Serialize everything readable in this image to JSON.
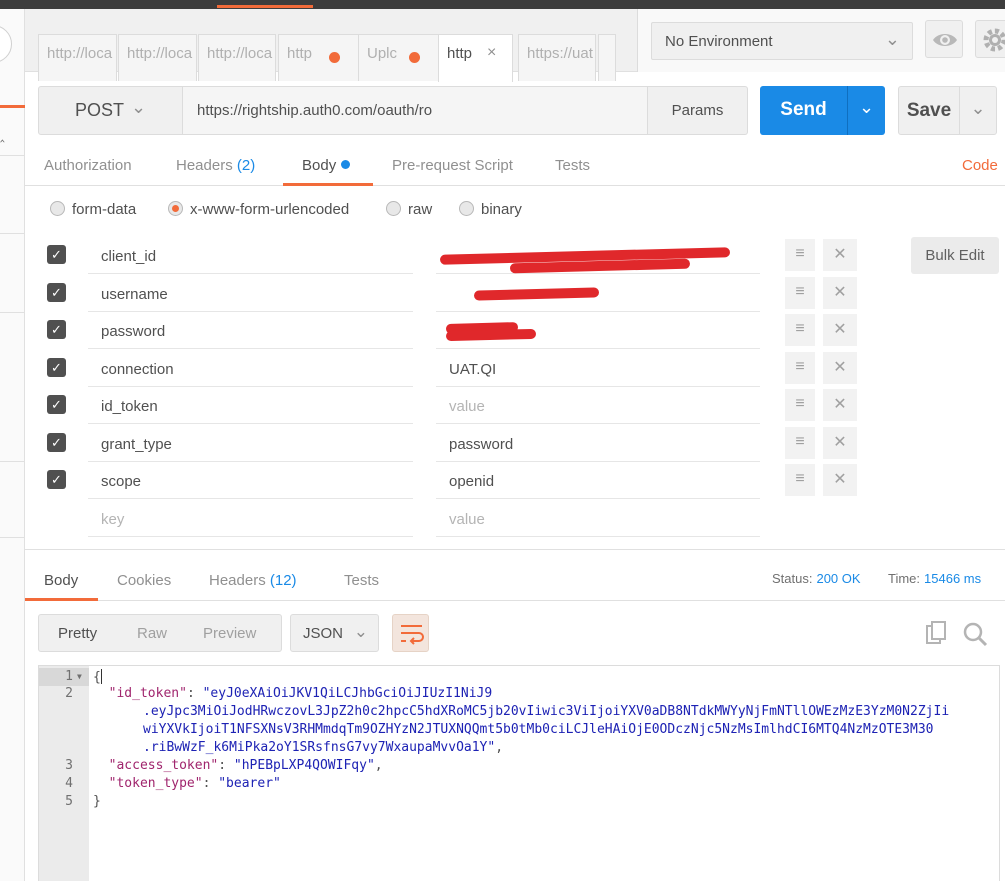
{
  "tabs": [
    {
      "label": "http://loca",
      "dot": false,
      "active": false
    },
    {
      "label": "http://loca",
      "dot": false,
      "active": false
    },
    {
      "label": "http://loca",
      "dot": false,
      "active": false
    },
    {
      "label": "http",
      "dot": true,
      "active": false
    },
    {
      "label": "Uplc",
      "dot": true,
      "active": false
    },
    {
      "label": "http",
      "dot": false,
      "active": true,
      "close": "×"
    },
    {
      "label": "https://uat",
      "dot": false,
      "active": false
    }
  ],
  "environment": {
    "selected": "No Environment"
  },
  "request": {
    "method": "POST",
    "url": "https://rightship.auth0.com/oauth/ro",
    "params_label": "Params",
    "send_label": "Send",
    "save_label": "Save"
  },
  "request_tabs": [
    {
      "label": "Authorization"
    },
    {
      "label": "Headers",
      "count": "(2)"
    },
    {
      "label": "Body"
    },
    {
      "label": "Pre-request Script"
    },
    {
      "label": "Tests"
    }
  ],
  "code_link": "Code",
  "body_types": [
    {
      "label": "form-data",
      "selected": false
    },
    {
      "label": "x-www-form-urlencoded",
      "selected": true
    },
    {
      "label": "raw",
      "selected": false
    },
    {
      "label": "binary",
      "selected": false
    }
  ],
  "kv_rows": [
    {
      "key": "client_id",
      "value": "",
      "checked": true
    },
    {
      "key": "username",
      "value": "",
      "checked": true
    },
    {
      "key": "password",
      "value": "",
      "checked": true
    },
    {
      "key": "connection",
      "value": "UAT.QI",
      "checked": true
    },
    {
      "key": "id_token",
      "value": "",
      "checked": true
    },
    {
      "key": "grant_type",
      "value": "password",
      "checked": true
    },
    {
      "key": "scope",
      "value": "openid",
      "checked": true
    }
  ],
  "kv_placeholders": {
    "key": "key",
    "value": "value"
  },
  "bulk_edit_label": "Bulk Edit",
  "response_tabs": [
    {
      "label": "Body"
    },
    {
      "label": "Cookies"
    },
    {
      "label": "Headers",
      "count": "(12)"
    },
    {
      "label": "Tests"
    }
  ],
  "status": {
    "label": "Status:",
    "value": "200 OK"
  },
  "time": {
    "label": "Time:",
    "value": "15466 ms"
  },
  "view_modes": [
    "Pretty",
    "Raw",
    "Preview"
  ],
  "format": "JSON",
  "code_lines": {
    "l1": "{",
    "id_token_key": "\"id_token\"",
    "id_token_p1": "\"eyJ0eXAiOiJKV1QiLCJhbGciOiJIUzI1NiJ9",
    "id_token_p2": ".eyJpc3MiOiJodHRwczovL3JpZ2h0c2hpcC5hdXRoMC5jb20vIiwic3ViIjoiYXV0aDB8NTdkMWYyNjFmNTllOWEzMzE3YzM0N2ZjIi",
    "id_token_p3": "wiYXVkIjoiT1NFSXNsV3RHMmdqTm9OZHYzN2JTUXNQQmt5b0tMb0ciLCJleHAiOjE0ODczNjc5NzMsImlhdCI6MTQ4NzMzOTE3M30",
    "id_token_p4": ".riBwWzF_k6MiPka2oY1SRsfnsG7vy7WxaupaMvvOa1Y\"",
    "access_token_key": "\"access_token\"",
    "access_token_val": "\"hPEBpLXP4QOWIFqy\"",
    "token_type_key": "\"token_type\"",
    "token_type_val": "\"bearer\"",
    "l5": "}"
  },
  "line_numbers": [
    "1",
    "2",
    "3",
    "4",
    "5"
  ]
}
